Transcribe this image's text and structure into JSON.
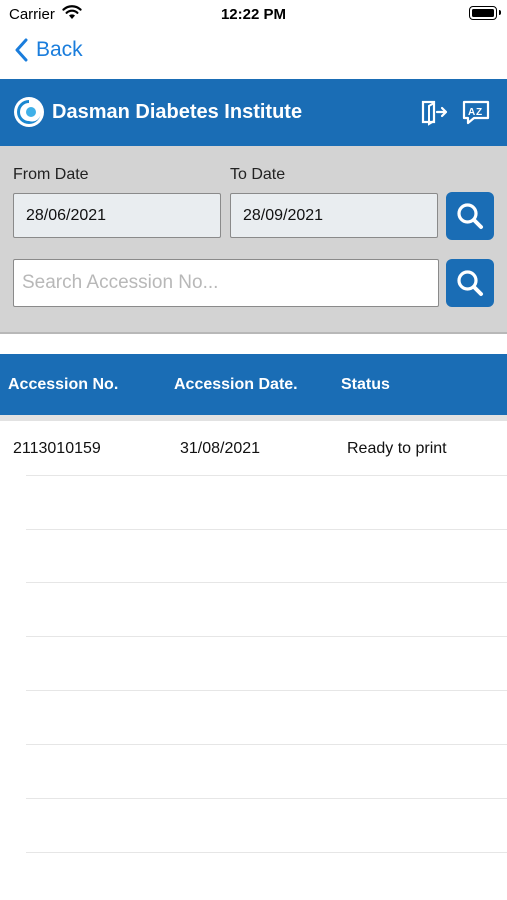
{
  "status_bar": {
    "carrier": "Carrier",
    "time": "12:22 PM"
  },
  "nav": {
    "back_label": "Back"
  },
  "header": {
    "title": "Dasman Diabetes Institute",
    "logout_icon": "logout-icon",
    "language_icon": "translate-icon"
  },
  "filter": {
    "from_label": "From Date",
    "to_label": "To Date",
    "from_value": "28/06/2021",
    "to_value": "28/09/2021",
    "search_placeholder": "Search Accession No..."
  },
  "table": {
    "columns": [
      "Accession No.",
      "Accession Date.",
      "Status"
    ],
    "rows": [
      {
        "accession_no": "2113010159",
        "accession_date": "31/08/2021",
        "status": "Ready to print"
      }
    ]
  },
  "colors": {
    "primary": "#1a6db5",
    "link": "#1a7ddc",
    "filter_bg": "#d3d3d3"
  }
}
